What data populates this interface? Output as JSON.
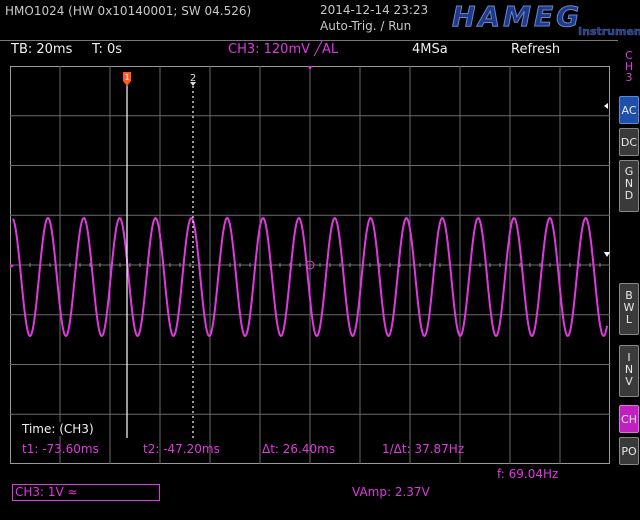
{
  "header": {
    "device": "HMO1024 (HW 0x10140001; SW 04.526)",
    "datetime": "2014-12-14 23:23",
    "trigger_mode": "Auto-Trig. / Run",
    "logo_brand": "HAMEG",
    "logo_sub": "Instruments"
  },
  "infobar": {
    "timebase": "TB: 20ms",
    "trigger_time": "T: 0s",
    "ch3_setting": "CH3: 120mV ╱AL",
    "sample_rate": "4MSa",
    "acquire_mode": "Refresh"
  },
  "sidemenu": {
    "channel": [
      "C",
      "H",
      "3"
    ],
    "coupling_ac": "AC",
    "coupling_dc": "DC",
    "coupling_gnd": [
      "G",
      "N",
      "D"
    ],
    "bwl": [
      "B",
      "W",
      "L"
    ],
    "inv": [
      "I",
      "N",
      "V"
    ],
    "ch": "CH",
    "po": "PO"
  },
  "cursors": {
    "title": "Time: (CH3)",
    "t1": "t1: -73.60ms",
    "t2": "t2: -47.20ms",
    "delta_t": "Δt: 26.40ms",
    "inv_delta_t": "1/Δt: 37.87Hz",
    "marker1": "1",
    "marker2": "2"
  },
  "measurements": {
    "frequency": "f: 69.04Hz",
    "vamp": "VAmp: 2.37V"
  },
  "footer": {
    "ch3_scale": "CH3: 1V ≈"
  },
  "colors": {
    "trace": "#e038e0",
    "ac_active": "#1f4fa8",
    "ch_active": "#c020c0",
    "trigger_marker": "#ff5a20"
  },
  "waveform": {
    "frequency_hz": 69.04,
    "amplitude_v": 2.37,
    "volts_per_div": 1,
    "time_per_div_ms": 20
  }
}
